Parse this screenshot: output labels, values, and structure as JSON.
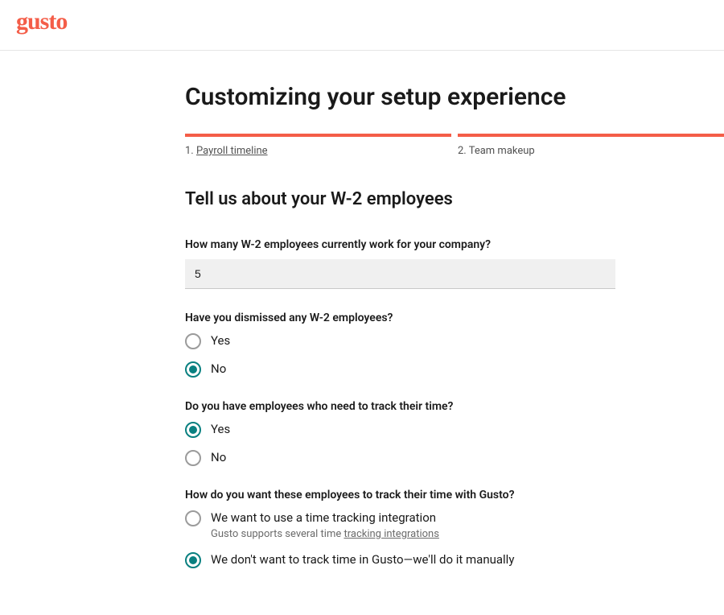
{
  "logo_text": "gusto",
  "page_title": "Customizing your setup experience",
  "progress": {
    "step1_num": "1.",
    "step1_label": "Payroll timeline",
    "step2_num": "2.",
    "step2_label": "Team makeup"
  },
  "section_title": "Tell us about your W-2 employees",
  "q_employee_count": {
    "label": "How many W-2 employees currently work for your company?",
    "value": "5"
  },
  "q_dismissed": {
    "label": "Have you dismissed any W-2 employees?",
    "opt_yes": "Yes",
    "opt_no": "No"
  },
  "q_track_time": {
    "label": "Do you have employees who need to track their time?",
    "opt_yes": "Yes",
    "opt_no": "No"
  },
  "q_track_method": {
    "label": "How do you want these employees to track their time with Gusto?",
    "opt_integration": "We want to use a time tracking integration",
    "opt_integration_sub_prefix": "Gusto supports several time ",
    "opt_integration_sub_link": "tracking integrations",
    "opt_manual": "We don't want to track time in Gusto—we'll do it manually"
  }
}
